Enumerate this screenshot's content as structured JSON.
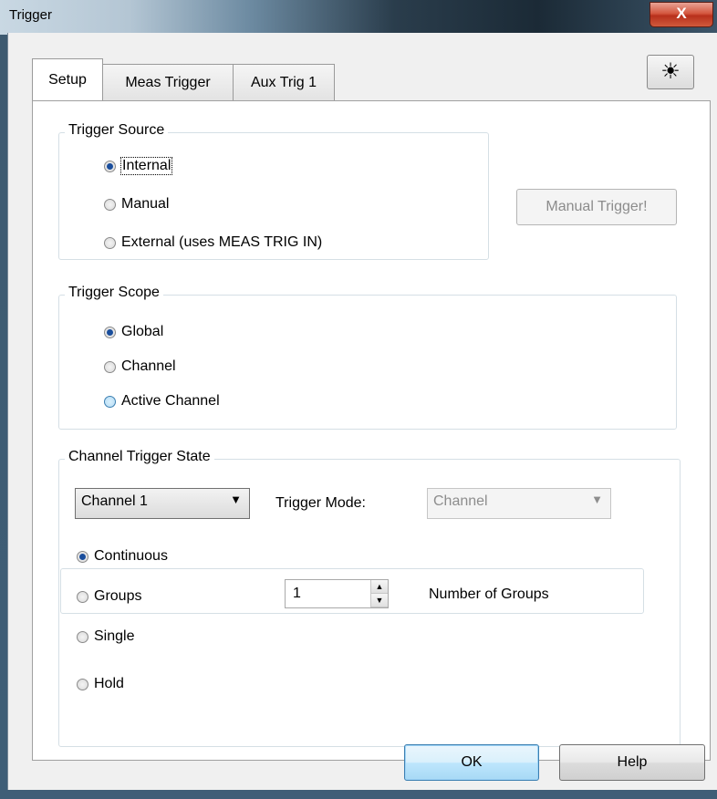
{
  "window": {
    "title": "Trigger",
    "close": "X"
  },
  "tabs": [
    {
      "label": "Setup",
      "active": true
    },
    {
      "label": "Meas Trigger",
      "active": false
    },
    {
      "label": "Aux Trig 1",
      "active": false
    }
  ],
  "sun_button": "☀",
  "trigger_source": {
    "legend": "Trigger Source",
    "options": [
      {
        "label": "Internal",
        "selected": true
      },
      {
        "label": "Manual",
        "selected": false
      },
      {
        "label": "External (uses MEAS TRIG IN)",
        "selected": false
      }
    ],
    "manual_trigger_button": "Manual Trigger!"
  },
  "trigger_scope": {
    "legend": "Trigger Scope",
    "options": [
      {
        "label": "Global",
        "selected": true
      },
      {
        "label": "Channel",
        "selected": false
      },
      {
        "label": "Active Channel",
        "selected": false
      }
    ]
  },
  "channel_trigger_state": {
    "legend": "Channel Trigger State",
    "channel_select": "Channel 1",
    "trigger_mode_label": "Trigger Mode:",
    "trigger_mode_select": "Channel",
    "options": [
      {
        "label": "Continuous",
        "selected": true
      },
      {
        "label": "Groups",
        "selected": false
      },
      {
        "label": "Single",
        "selected": false
      },
      {
        "label": "Hold",
        "selected": false
      }
    ],
    "groups_value": "1",
    "number_of_groups_label": "Number of Groups"
  },
  "footer": {
    "ok": "OK",
    "help": "Help"
  }
}
